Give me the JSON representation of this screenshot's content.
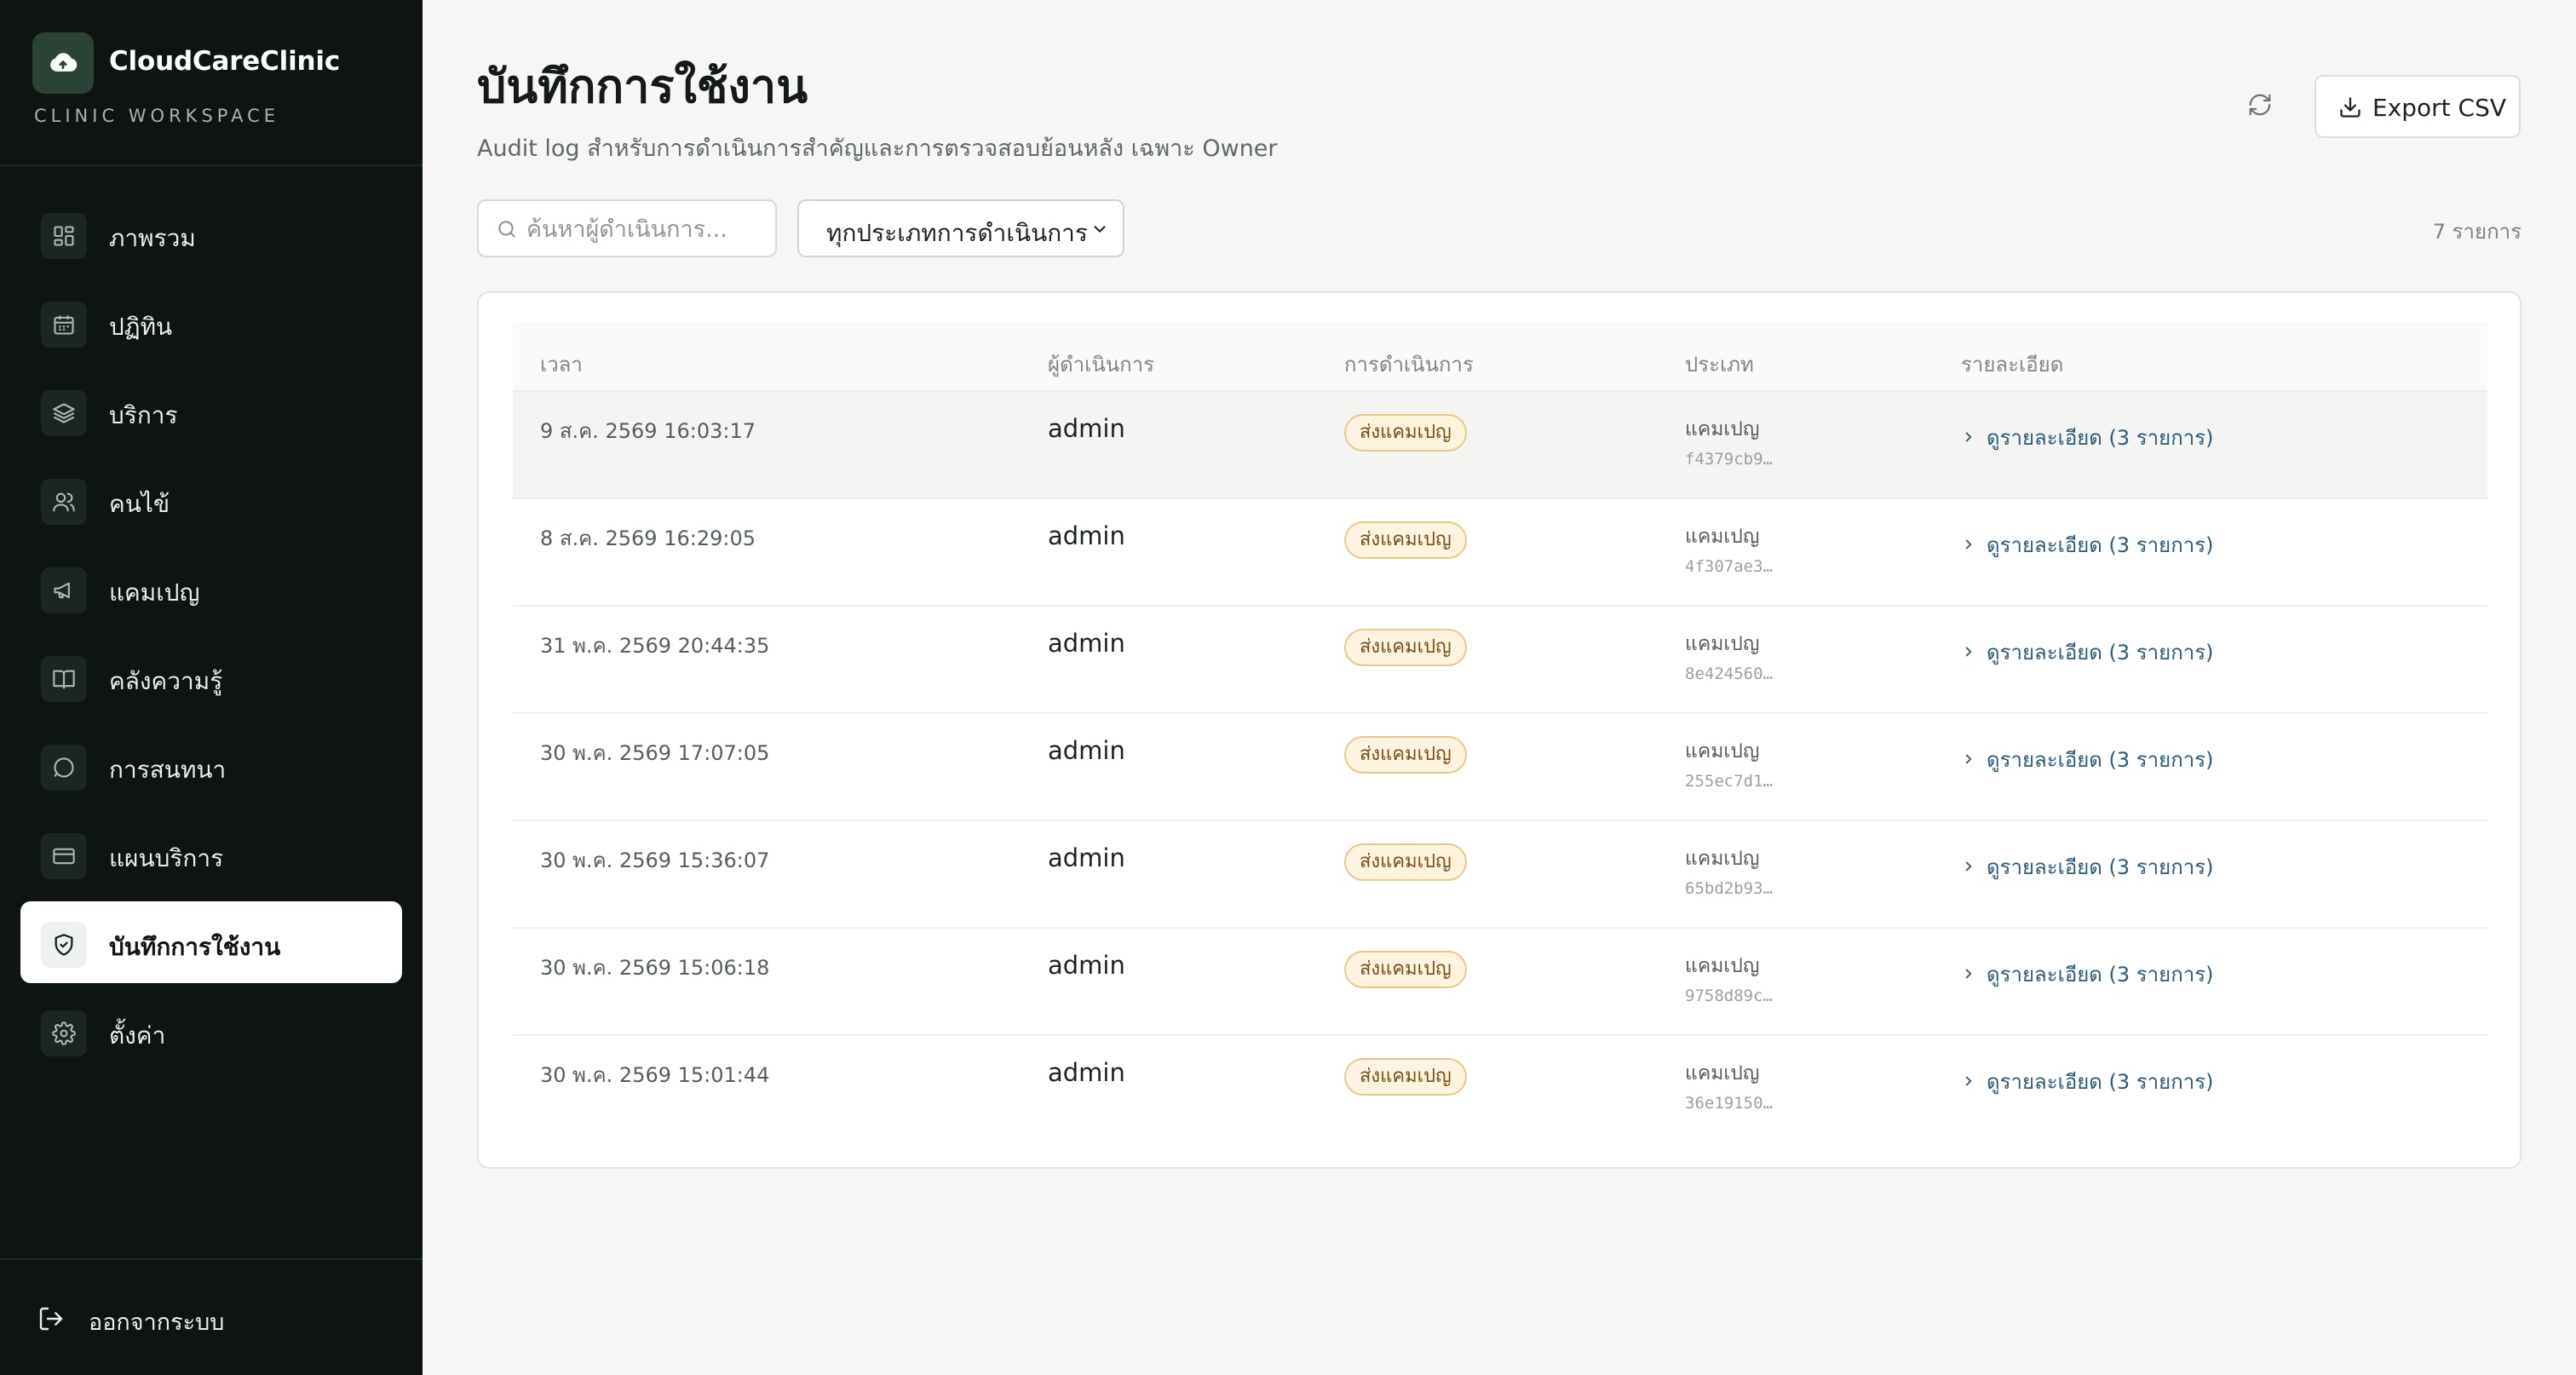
{
  "brand": {
    "name": "CloudCareClinic",
    "subtitle": "CLINIC WORKSPACE",
    "logo_icon": "cloud-icon"
  },
  "sidebar": {
    "items": [
      {
        "label": "ภาพรวม",
        "icon": "dashboard-grid-icon",
        "active": false
      },
      {
        "label": "ปฏิทิน",
        "icon": "calendar-icon",
        "active": false
      },
      {
        "label": "บริการ",
        "icon": "layers-icon",
        "active": false
      },
      {
        "label": "คนไข้",
        "icon": "users-icon",
        "active": false
      },
      {
        "label": "แคมเปญ",
        "icon": "megaphone-icon",
        "active": false
      },
      {
        "label": "คลังความรู้",
        "icon": "book-icon",
        "active": false
      },
      {
        "label": "การสนทนา",
        "icon": "chat-bubble-icon",
        "active": false
      },
      {
        "label": "แผนบริการ",
        "icon": "credit-card-icon",
        "active": false
      },
      {
        "label": "บันทึกการใช้งาน",
        "icon": "shield-check-icon",
        "active": true
      },
      {
        "label": "ตั้งค่า",
        "icon": "gear-icon",
        "active": false
      }
    ],
    "logout_label": "ออกจากระบบ"
  },
  "header": {
    "title": "บันทึกการใช้งาน",
    "subtitle": "Audit log สำหรับการดำเนินการสำคัญและการตรวจสอบย้อนหลัง เฉพาะ Owner",
    "export_label": "Export CSV"
  },
  "filters": {
    "search_placeholder": "ค้นหาผู้ดำเนินการ...",
    "action_type_selected": "ทุกประเภทการดำเนินการ",
    "count_text": "7 รายการ"
  },
  "table": {
    "columns": [
      "เวลา",
      "ผู้ดำเนินการ",
      "การดำเนินการ",
      "ประเภท",
      "รายละเอียด"
    ],
    "rows": [
      {
        "time": "9 ส.ค. 2569 16:03:17",
        "actor": "admin",
        "action": "ส่งแคมเปญ",
        "type": "แคมเปญ",
        "id": "f4379cb9…",
        "detail": "ดูรายละเอียด (3 รายการ)"
      },
      {
        "time": "8 ส.ค. 2569 16:29:05",
        "actor": "admin",
        "action": "ส่งแคมเปญ",
        "type": "แคมเปญ",
        "id": "4f307ae3…",
        "detail": "ดูรายละเอียด (3 รายการ)"
      },
      {
        "time": "31 พ.ค. 2569 20:44:35",
        "actor": "admin",
        "action": "ส่งแคมเปญ",
        "type": "แคมเปญ",
        "id": "8e424560…",
        "detail": "ดูรายละเอียด (3 รายการ)"
      },
      {
        "time": "30 พ.ค. 2569 17:07:05",
        "actor": "admin",
        "action": "ส่งแคมเปญ",
        "type": "แคมเปญ",
        "id": "255ec7d1…",
        "detail": "ดูรายละเอียด (3 รายการ)"
      },
      {
        "time": "30 พ.ค. 2569 15:36:07",
        "actor": "admin",
        "action": "ส่งแคมเปญ",
        "type": "แคมเปญ",
        "id": "65bd2b93…",
        "detail": "ดูรายละเอียด (3 รายการ)"
      },
      {
        "time": "30 พ.ค. 2569 15:06:18",
        "actor": "admin",
        "action": "ส่งแคมเปญ",
        "type": "แคมเปญ",
        "id": "9758d89c…",
        "detail": "ดูรายละเอียด (3 รายการ)"
      },
      {
        "time": "30 พ.ค. 2569 15:01:44",
        "actor": "admin",
        "action": "ส่งแคมเปญ",
        "type": "แคมเปญ",
        "id": "36e19150…",
        "detail": "ดูรายละเอียด (3 รายการ)"
      }
    ]
  },
  "colors": {
    "sidebar_bg": "#0e1411",
    "page_bg": "#f6f6f4",
    "badge_bg": "#fdf3df",
    "badge_border": "#e9c988",
    "link": "#2e5b78"
  }
}
